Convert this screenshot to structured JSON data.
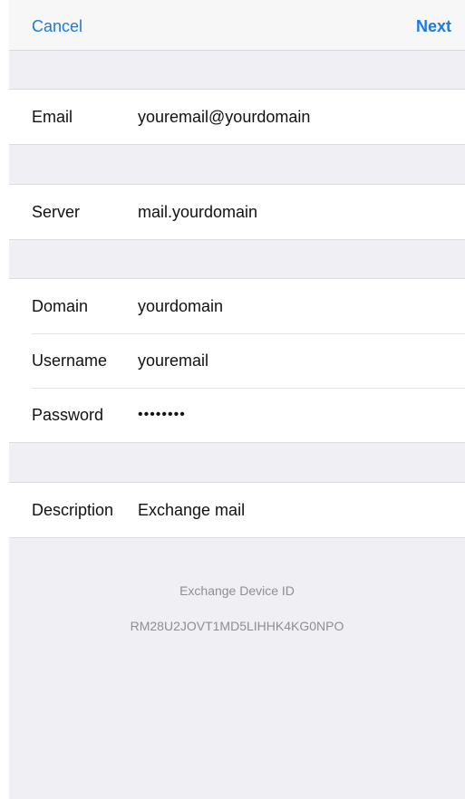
{
  "nav": {
    "cancel": "Cancel",
    "next": "Next"
  },
  "fields": {
    "email": {
      "label": "Email",
      "value": "youremail@yourdomain"
    },
    "server": {
      "label": "Server",
      "value": "mail.yourdomain"
    },
    "domain": {
      "label": "Domain",
      "value": "yourdomain"
    },
    "username": {
      "label": "Username",
      "value": "youremail"
    },
    "password": {
      "label": "Password",
      "value": "••••••••"
    },
    "description": {
      "label": "Description",
      "value": "Exchange mail"
    }
  },
  "footer": {
    "title": "Exchange Device ID",
    "device_id": "RM28U2JOVT1MD5LIHHK4KG0NPO"
  },
  "colors": {
    "accent": "#1a7ae5",
    "background": "#efeff4"
  }
}
